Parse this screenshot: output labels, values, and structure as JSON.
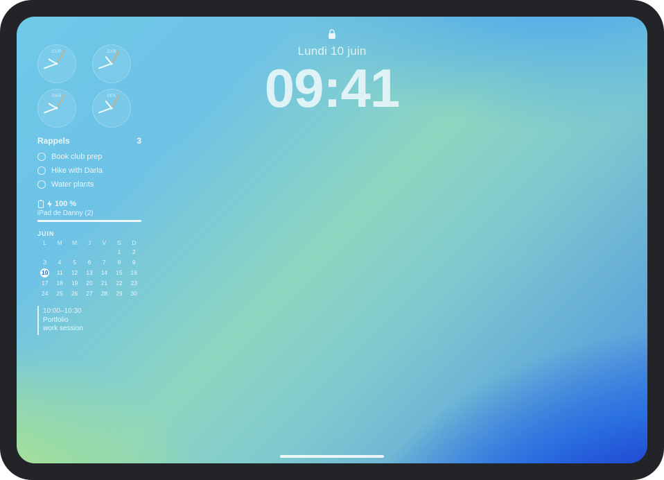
{
  "lockscreen": {
    "date": "Lundi 10 juin",
    "time": "09:41"
  },
  "widgets": {
    "world_clock": {
      "clocks": [
        {
          "city": "CUP",
          "hour_deg": 300,
          "min_deg": 250,
          "sec_deg": 30
        },
        {
          "city": "DXB",
          "hour_deg": 320,
          "min_deg": 250,
          "sec_deg": 30
        },
        {
          "city": "PAR",
          "hour_deg": 300,
          "min_deg": 250,
          "sec_deg": 30
        },
        {
          "city": "PEK",
          "hour_deg": 320,
          "min_deg": 250,
          "sec_deg": 30
        }
      ]
    },
    "reminders": {
      "title": "Rappels",
      "count": "3",
      "items": [
        {
          "label": "Book club prep"
        },
        {
          "label": "Hike with Darla"
        },
        {
          "label": "Water plants"
        }
      ]
    },
    "battery": {
      "percent_label": "100 %",
      "device_label": "iPad de Danny (2)",
      "fill_pct": 100
    },
    "calendar": {
      "month_label": "JUIN",
      "dow": [
        "L",
        "M",
        "M",
        "J",
        "V",
        "S",
        "D"
      ],
      "leading_blanks": 5,
      "days": 30,
      "today": 10
    },
    "event": {
      "time": "10:00–10:30",
      "title_line1": "Portfolio",
      "title_line2": "work session"
    }
  }
}
